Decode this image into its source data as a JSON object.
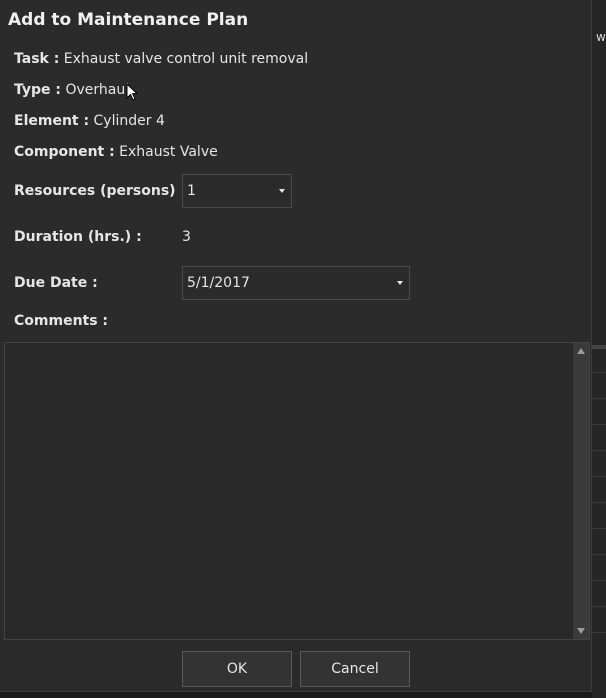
{
  "dialog": {
    "title": "Add to Maintenance Plan",
    "task": {
      "label": "Task :",
      "value": "Exhaust valve control unit removal"
    },
    "type": {
      "label": "Type :",
      "value": "Overhaul"
    },
    "element": {
      "label": "Element :",
      "value": "Cylinder 4"
    },
    "component": {
      "label": "Component :",
      "value": "Exhaust Valve"
    },
    "resources": {
      "label": "Resources (persons) :",
      "value": "1"
    },
    "duration": {
      "label": "Duration (hrs.) :",
      "value": "3"
    },
    "due_date": {
      "label": "Due Date :",
      "value": "5/1/2017"
    },
    "comments": {
      "label": "Comments :",
      "value": ""
    },
    "ok_label": "OK",
    "cancel_label": "Cancel"
  },
  "backdrop": {
    "partial_text": "w"
  },
  "icons": {
    "cursor": "mouse-pointer-icon",
    "dropdown": "caret-down-icon",
    "scroll_up": "scroll-up-arrow-icon",
    "scroll_down": "scroll-down-arrow-icon"
  }
}
